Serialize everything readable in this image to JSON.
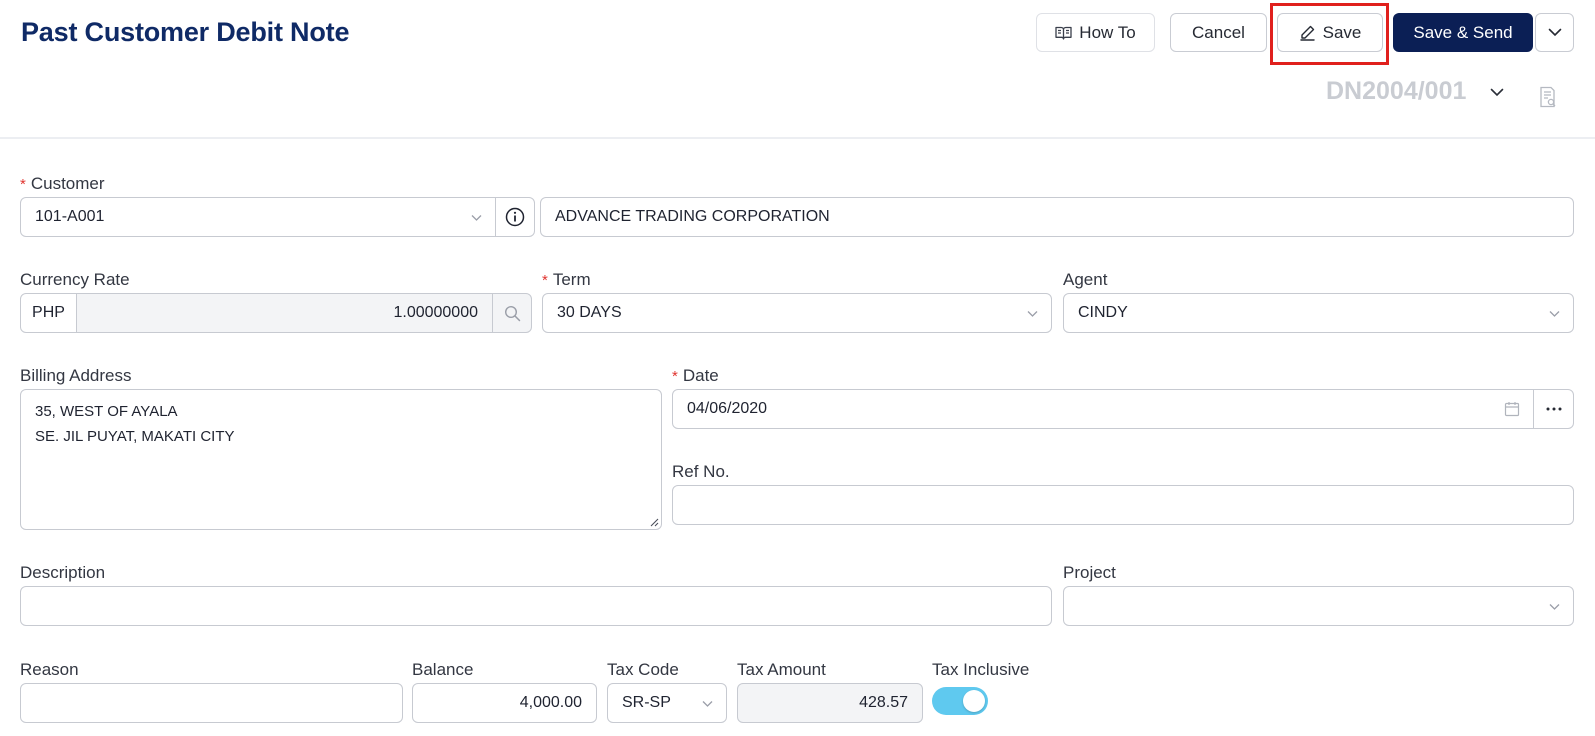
{
  "header": {
    "title": "Past Customer Debit Note",
    "buttons": {
      "how_to": "How To",
      "cancel": "Cancel",
      "save": "Save",
      "save_send": "Save & Send"
    },
    "doc_number": "DN2004/001"
  },
  "form": {
    "customer": {
      "label": "Customer",
      "code": "101-A001",
      "name": "ADVANCE TRADING CORPORATION"
    },
    "currency_rate": {
      "label": "Currency Rate",
      "currency": "PHP",
      "rate": "1.00000000"
    },
    "term": {
      "label": "Term",
      "value": "30 DAYS"
    },
    "agent": {
      "label": "Agent",
      "value": "CINDY"
    },
    "billing_address": {
      "label": "Billing Address",
      "line1": "35, WEST OF AYALA",
      "line2": "SE. JIL PUYAT, MAKATI CITY"
    },
    "date": {
      "label": "Date",
      "value": "04/06/2020"
    },
    "ref_no": {
      "label": "Ref No.",
      "value": ""
    },
    "description": {
      "label": "Description",
      "value": ""
    },
    "project": {
      "label": "Project",
      "value": ""
    },
    "reason": {
      "label": "Reason",
      "value": ""
    },
    "balance": {
      "label": "Balance",
      "value": "4,000.00"
    },
    "tax_code": {
      "label": "Tax Code",
      "value": "SR-SP"
    },
    "tax_amount": {
      "label": "Tax Amount",
      "value": "428.57"
    },
    "tax_inclusive": {
      "label": "Tax Inclusive",
      "enabled": true
    }
  },
  "colors": {
    "title": "#0f2a66",
    "primary_button": "#0b1f55",
    "required_marker": "#e0342f",
    "highlight": "#e0201d",
    "toggle_on": "#5fc9ef"
  }
}
